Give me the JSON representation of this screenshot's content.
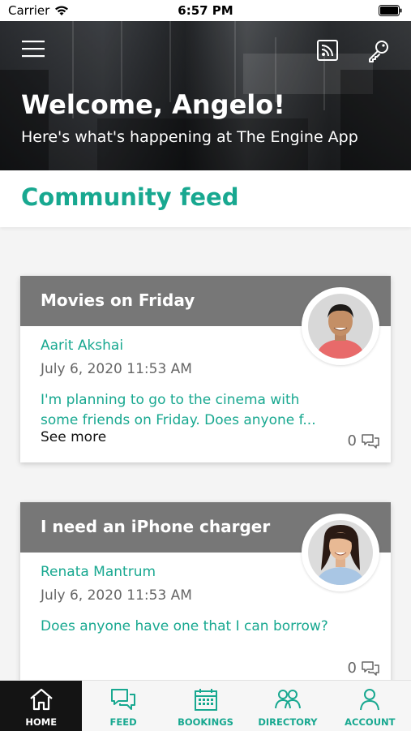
{
  "status_bar": {
    "carrier": "Carrier",
    "time": "6:57 PM"
  },
  "header": {
    "welcome": "Welcome, Angelo!",
    "subtitle": "Here's what's happening at The Engine App",
    "menu_icon": "hamburger-menu-icon",
    "cast_icon": "rss-feed-icon",
    "key_icon": "key-icon"
  },
  "feed": {
    "title": "Community feed",
    "posts": [
      {
        "title": "Movies on Friday",
        "author": "Aarit Akshai",
        "date": "July 6, 2020 11:53 AM",
        "body": "I'm planning to go to the cinema with some friends on Friday. Does anyone f...",
        "see_more": "See more",
        "comments": "0"
      },
      {
        "title": "I need an iPhone charger",
        "author": "Renata Mantrum",
        "date": "July 6, 2020 11:53 AM",
        "body": "Does anyone have one that I can borrow?",
        "comments": "0"
      }
    ]
  },
  "tabs": [
    {
      "label": "HOME",
      "icon": "home-icon",
      "active": true
    },
    {
      "label": "FEED",
      "icon": "chat-bubbles-icon"
    },
    {
      "label": "BOOKINGS",
      "icon": "calendar-icon"
    },
    {
      "label": "DIRECTORY",
      "icon": "people-icon"
    },
    {
      "label": "ACCOUNT",
      "icon": "person-icon"
    }
  ],
  "colors": {
    "accent": "#18a890",
    "card_header": "#777777",
    "tab_active_bg": "#141414"
  }
}
